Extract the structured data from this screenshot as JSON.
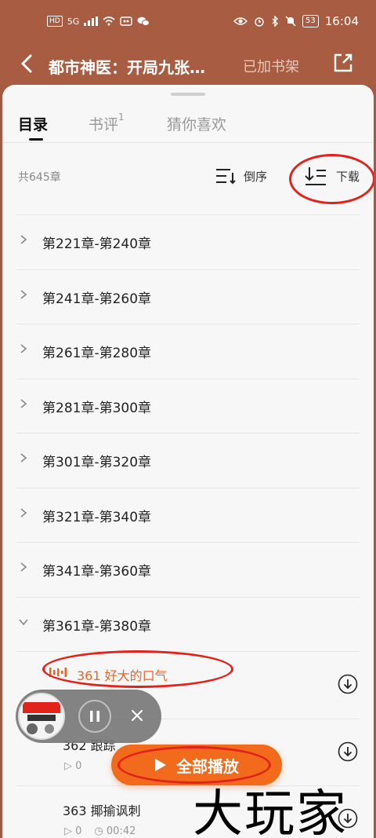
{
  "status_bar": {
    "left_hd": "HD",
    "left_signal": "5G",
    "battery": "53",
    "time": "16:04"
  },
  "header": {
    "title": "都市神医：开局九张…",
    "shelf_label": "已加书架",
    "icons": [
      "back-arrow-icon",
      "share-icon"
    ]
  },
  "tabs": {
    "catalog": "目录",
    "reviews": "书评",
    "reviews_count": "1",
    "recommend": "猜你喜欢"
  },
  "toolbar": {
    "count": "共645章",
    "sort_label": "倒序",
    "download_label": "下载"
  },
  "groups": [
    {
      "label": "第221章-第240章"
    },
    {
      "label": "第241章-第260章"
    },
    {
      "label": "第261章-第280章"
    },
    {
      "label": "第281章-第300章"
    },
    {
      "label": "第301章-第320章"
    },
    {
      "label": "第321章-第340章"
    },
    {
      "label": "第341章-第360章"
    },
    {
      "label": "第361章-第380章"
    }
  ],
  "chapters": [
    {
      "title": "361 好大的口气",
      "plays": "",
      "duration": ""
    },
    {
      "title": "362 跟踪",
      "plays": "0",
      "duration": ""
    },
    {
      "title": "363 揶揄讽刺",
      "plays": "0",
      "duration": "00:42"
    }
  ],
  "player": {
    "play_all_label": "全部播放"
  },
  "watermark": "大玩家",
  "colors": {
    "header_bg": "#a85d42",
    "accent_orange": "#f26a1b",
    "playing_text": "#e3662b",
    "annotation_red": "#e0231b"
  }
}
